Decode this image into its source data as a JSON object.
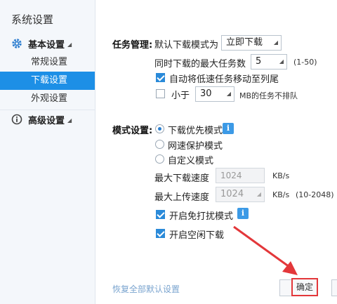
{
  "sidebar": {
    "title": "系统设置",
    "group_basic": "基本设置",
    "items": [
      {
        "label": "常规设置"
      },
      {
        "label": "下载设置"
      },
      {
        "label": "外观设置"
      }
    ],
    "group_advanced": "高级设置"
  },
  "task": {
    "section_label": "任务管理:",
    "default_mode_label": "默认下载模式为",
    "default_mode_value": "立即下载",
    "max_tasks_label": "同时下载的最大任务数",
    "max_tasks_value": "5",
    "max_tasks_range": "(1-50)",
    "auto_move_label": "自动将低速任务移动至列尾",
    "auto_move_checked": true,
    "less_than_label": "小于",
    "less_than_value": "30",
    "less_than_suffix": "MB的任务不排队",
    "less_than_checked": false
  },
  "mode": {
    "section_label": "模式设置:",
    "options": [
      {
        "label": "下载优先模式",
        "selected": true
      },
      {
        "label": "网速保护模式",
        "selected": false
      },
      {
        "label": "自定义模式",
        "selected": false
      }
    ],
    "max_download_label": "最大下载速度",
    "max_download_value": "1024",
    "max_download_unit": "KB/s",
    "max_upload_label": "最大上传速度",
    "max_upload_value": "1024",
    "max_upload_unit": "KB/s",
    "max_upload_range": "(10-2048)",
    "dnd_label": "开启免打扰模式",
    "dnd_checked": true,
    "idle_label": "开启空闲下载",
    "idle_checked": true
  },
  "footer": {
    "restore_defaults": "恢复全部默认设置",
    "ok_button": "确定"
  },
  "colors": {
    "accent": "#1d8fe6",
    "annotation": "#e3373a"
  }
}
